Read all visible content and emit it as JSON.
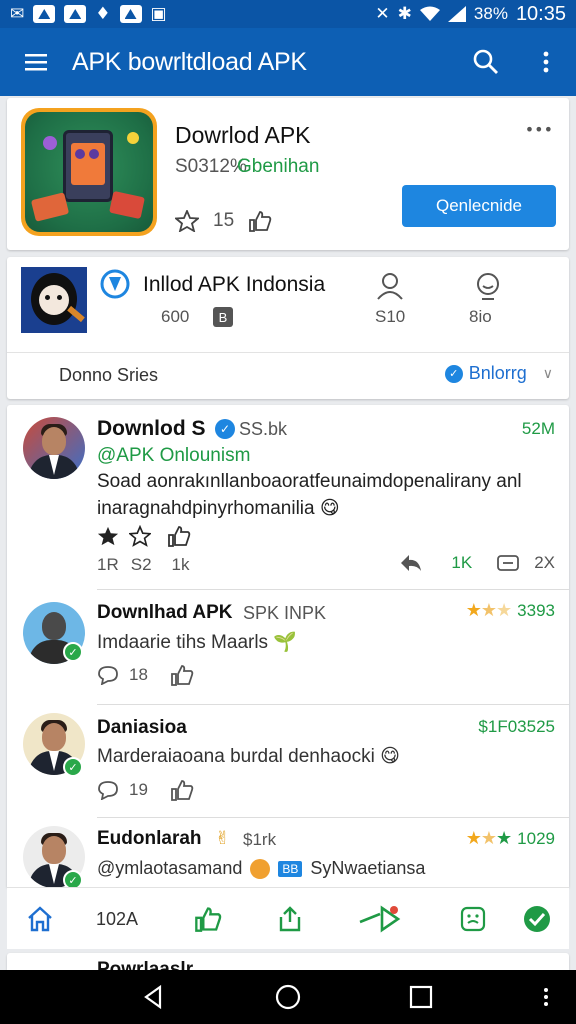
{
  "status_bar": {
    "battery": "38%",
    "time": "10:35",
    "icons": [
      "mail-icon",
      "photo-icon",
      "photo-icon",
      "shield-icon",
      "chart-icon",
      "tv-icon"
    ],
    "right_icons": [
      "mute-icon",
      "bluetooth-icon",
      "wifi-icon",
      "signal-icon"
    ]
  },
  "app_bar": {
    "title": "APK bowrltdload APK",
    "menu_icon": "hamburger-icon",
    "search_icon": "search-icon",
    "more_icon": "more-vert-icon"
  },
  "app_card": {
    "name": "Dowrlod APK",
    "price": "S0312%",
    "subtitle": "Gbenihan",
    "rating_count": "15",
    "button_label": "Qenlecnide",
    "more": "•••"
  },
  "channel_card": {
    "name": "Inllod APK Indonsia",
    "stat_a": "600",
    "stat_a_badge": "B",
    "stat_b": "S10",
    "stat_c": "8io",
    "series_label": "Donno Sries",
    "follow_label": "Bnlorrg",
    "follow_chevron": "∨"
  },
  "posts": [
    {
      "name": "Downlod  S",
      "meta": "SS.bk",
      "right": "52M",
      "handle": "@APK Onlounism",
      "text_line1": "Soad aonrakınllanboaoratfeunaimdopenalirany anl",
      "text_line2": "inaragnahdpinyrhomanilia",
      "emoji": "😋",
      "count_a": "1R",
      "count_b": "S2",
      "count_c": "1k",
      "right_count_a": "1K",
      "right_count_b": "2X"
    },
    {
      "name": "Downlhad APK",
      "meta": "SPK INPK",
      "right": "3393",
      "stars": "3393",
      "text_line1": "Imdaarie tihs Maarls",
      "emoji": "🌱",
      "count": "18"
    },
    {
      "name": "Daniasioa",
      "right": "$1F03525",
      "text_line1": "Marderaiaoana burdal denhaocki",
      "emoji": "😋",
      "count": "19"
    },
    {
      "name": "Eudonlarah",
      "meta": "$1rk",
      "right": "1029",
      "handle": "@ymlaotasamand",
      "handle_tail": "SyNwaetiansa",
      "badge": "BB"
    }
  ],
  "bottom_bar": {
    "home_icon": "home-icon",
    "count": "102A",
    "like_icon": "thumbs-up-icon",
    "share_icon": "share-icon",
    "send_icon": "send-icon",
    "face_icon": "face-icon",
    "check_icon": "check-icon"
  },
  "peek_text": "Powrlaaslr",
  "nav_bar": {
    "back": "back-icon",
    "home": "home-icon",
    "recents": "recents-icon",
    "more": "more-icon"
  },
  "colors": {
    "primary": "#0d5fb4",
    "status": "#0b55a6",
    "accent_blue": "#1e86e0",
    "green": "#1f9a45",
    "star": "#f2a81d"
  }
}
